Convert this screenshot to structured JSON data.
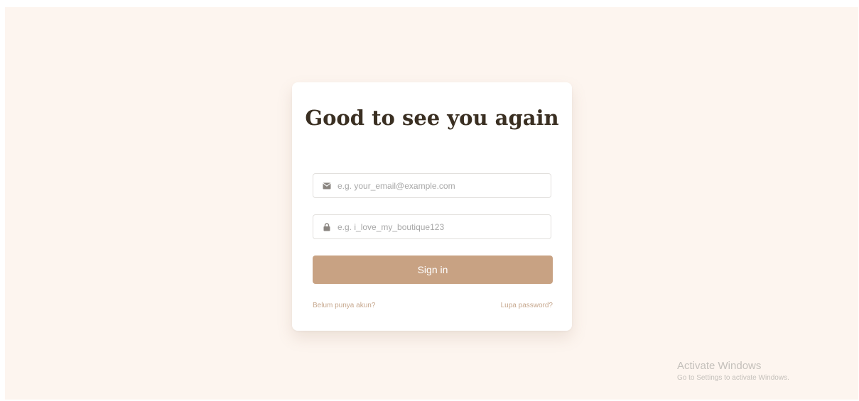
{
  "login": {
    "title": "Good to see you again",
    "email": {
      "placeholder": "e.g. your_email@example.com",
      "value": "",
      "icon": "envelope-icon"
    },
    "password": {
      "placeholder": "e.g. i_love_my_boutique123",
      "value": "",
      "icon": "lock-icon"
    },
    "submit_label": "Sign in",
    "register_link": "Belum punya akun?",
    "forgot_link": "Lupa password?"
  },
  "watermark": {
    "title": "Activate Windows",
    "subtitle": "Go to Settings to activate Windows."
  },
  "colors": {
    "background": "#fdf5ef",
    "card": "#ffffff",
    "accent": "#c8a283",
    "link": "#c6a78d",
    "title": "#3a2f22"
  }
}
